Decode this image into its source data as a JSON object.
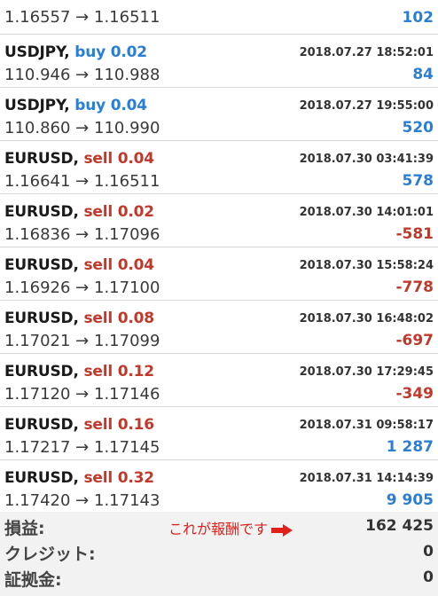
{
  "trades": [
    {
      "symbol": "",
      "side": "",
      "volume": "",
      "time": "",
      "open": "1.16557",
      "close": "1.16511",
      "profit": "102",
      "sign": "pos"
    },
    {
      "symbol": "USDJPY,",
      "side": "buy",
      "volume": "0.02",
      "time": "2018.07.27 18:52:01",
      "open": "110.946",
      "close": "110.988",
      "profit": "84",
      "sign": "pos"
    },
    {
      "symbol": "USDJPY,",
      "side": "buy",
      "volume": "0.04",
      "time": "2018.07.27 19:55:00",
      "open": "110.860",
      "close": "110.990",
      "profit": "520",
      "sign": "pos"
    },
    {
      "symbol": "EURUSD,",
      "side": "sell",
      "volume": "0.04",
      "time": "2018.07.30 03:41:39",
      "open": "1.16641",
      "close": "1.16511",
      "profit": "578",
      "sign": "pos"
    },
    {
      "symbol": "EURUSD,",
      "side": "sell",
      "volume": "0.02",
      "time": "2018.07.30 14:01:01",
      "open": "1.16836",
      "close": "1.17096",
      "profit": "-581",
      "sign": "neg"
    },
    {
      "symbol": "EURUSD,",
      "side": "sell",
      "volume": "0.04",
      "time": "2018.07.30 15:58:24",
      "open": "1.16926",
      "close": "1.17100",
      "profit": "-778",
      "sign": "neg"
    },
    {
      "symbol": "EURUSD,",
      "side": "sell",
      "volume": "0.08",
      "time": "2018.07.30 16:48:02",
      "open": "1.17021",
      "close": "1.17099",
      "profit": "-697",
      "sign": "neg"
    },
    {
      "symbol": "EURUSD,",
      "side": "sell",
      "volume": "0.12",
      "time": "2018.07.30 17:29:45",
      "open": "1.17120",
      "close": "1.17146",
      "profit": "-349",
      "sign": "neg"
    },
    {
      "symbol": "EURUSD,",
      "side": "sell",
      "volume": "0.16",
      "time": "2018.07.31 09:58:17",
      "open": "1.17217",
      "close": "1.17145",
      "profit": "1 287",
      "sign": "pos"
    },
    {
      "symbol": "EURUSD,",
      "side": "sell",
      "volume": "0.32",
      "time": "2018.07.31 14:14:39",
      "open": "1.17420",
      "close": "1.17143",
      "profit": "9 905",
      "sign": "pos"
    }
  ],
  "arrow": "→",
  "summary": {
    "profit_label": "損益:",
    "profit_value": "162 425",
    "annotation": "これが報酬です",
    "credit_label": "クレジット:",
    "credit_value": "0",
    "deposit_label": "証拠金:",
    "deposit_value": "0"
  },
  "colors": {
    "buy": "#2a7fd4",
    "sell": "#c0392b",
    "positive": "#2a7fd4",
    "negative": "#c0392b",
    "annotation": "#e0201a"
  },
  "icons": [
    "right-arrow-icon"
  ]
}
